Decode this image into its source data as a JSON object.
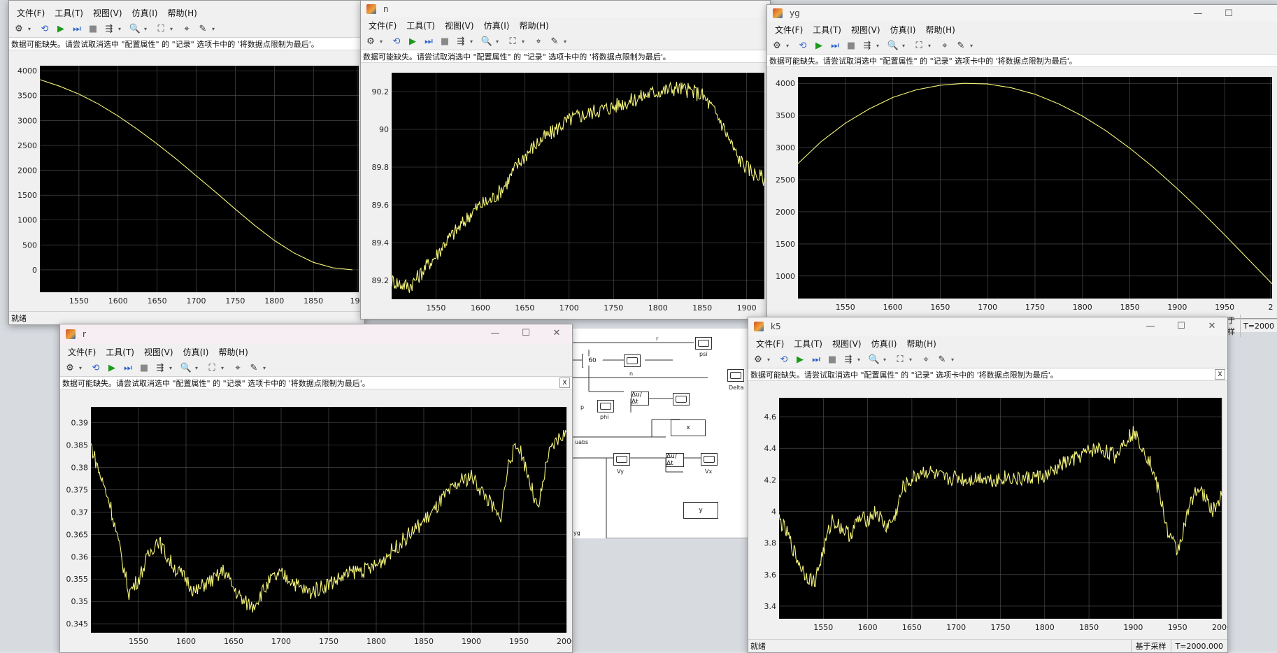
{
  "menus": [
    "文件(F)",
    "工具(T)",
    "视图(V)",
    "仿真(I)",
    "帮助(H)"
  ],
  "warning": "数据可能缺失。请尝试取消选中 \"配置属性\" 的 \"记录\" 选项卡中的 '将数据点限制为最后'。",
  "warning_close": "X",
  "status": {
    "ready": "就绪",
    "sample_based": "基于采样",
    "time_full": "T=2000.000",
    "time_short": "T=2000"
  },
  "window_controls": {
    "minimize": "—",
    "maximize": "☐",
    "close": "✕"
  },
  "toolbar_icons": [
    "gear-icon",
    "restore-icon",
    "play-icon",
    "step-forward-icon",
    "stop-icon",
    "highlight-icon",
    "zoom-icon",
    "fit-icon",
    "cursor-icon",
    "edit-icon"
  ],
  "trace_color": "#f5f57a",
  "windows": {
    "w1": {
      "title": ""
    },
    "n": {
      "title": "n"
    },
    "yg": {
      "title": "yg"
    },
    "r": {
      "title": "r"
    },
    "k5": {
      "title": "k5"
    }
  },
  "diagram": {
    "gain_label": "60",
    "labels": [
      "r",
      "psi",
      "n",
      "Delta",
      "p",
      "phi",
      "uabs",
      "x",
      "Vy",
      "Vx",
      "y",
      "yg"
    ],
    "deriv_label": "Δu/Δt"
  },
  "chart_data": [
    {
      "id": "w1",
      "type": "line",
      "x": [
        1500,
        1525,
        1550,
        1575,
        1600,
        1625,
        1650,
        1675,
        1700,
        1725,
        1750,
        1775,
        1800,
        1825,
        1850,
        1875,
        1900
      ],
      "series": [
        {
          "values": [
            3820,
            3690,
            3530,
            3330,
            3090,
            2820,
            2530,
            2220,
            1890,
            1560,
            1220,
            890,
            590,
            340,
            150,
            40,
            0
          ]
        }
      ],
      "xlim": [
        1500,
        1908
      ],
      "ylim": [
        -450,
        4100
      ],
      "xticks": [
        1550,
        1600,
        1650,
        1700,
        1750,
        1800,
        1850,
        "190"
      ],
      "yticks": [
        0,
        500,
        1000,
        1500,
        2000,
        2500,
        3000,
        3500,
        4000
      ]
    },
    {
      "id": "n",
      "type": "line",
      "x": [
        1500,
        1510,
        1520,
        1530,
        1540,
        1550,
        1560,
        1570,
        1580,
        1590,
        1600,
        1610,
        1620,
        1630,
        1640,
        1650,
        1660,
        1670,
        1680,
        1690,
        1700,
        1710,
        1720,
        1730,
        1740,
        1750,
        1760,
        1770,
        1780,
        1790,
        1800,
        1810,
        1820,
        1830,
        1840,
        1850,
        1860,
        1870,
        1880,
        1890,
        1900,
        1910,
        1920
      ],
      "series": [
        {
          "values": [
            89.2,
            89.18,
            89.17,
            89.22,
            89.28,
            89.33,
            89.4,
            89.45,
            89.5,
            89.56,
            89.6,
            89.62,
            89.66,
            89.72,
            89.8,
            89.86,
            89.91,
            89.95,
            89.98,
            90.02,
            90.05,
            90.07,
            90.08,
            90.1,
            90.11,
            90.12,
            90.14,
            90.15,
            90.17,
            90.19,
            90.2,
            90.21,
            90.22,
            90.21,
            90.2,
            90.18,
            90.12,
            90.05,
            89.95,
            89.85,
            89.8,
            89.76,
            89.74
          ]
        }
      ],
      "xlim": [
        1500,
        1920
      ],
      "ylim": [
        89.1,
        90.3
      ],
      "xticks": [
        1550,
        1600,
        1650,
        1700,
        1750,
        1800,
        1850,
        1900
      ],
      "yticks": [
        89.2,
        89.4,
        89.6,
        89.8,
        90,
        90.2
      ],
      "noisy": true
    },
    {
      "id": "yg",
      "type": "line",
      "x": [
        1500,
        1525,
        1550,
        1575,
        1600,
        1625,
        1650,
        1675,
        1700,
        1725,
        1750,
        1775,
        1800,
        1825,
        1850,
        1875,
        1900,
        1925,
        1950,
        1975,
        2000
      ],
      "series": [
        {
          "values": [
            2750,
            3100,
            3380,
            3600,
            3780,
            3900,
            3970,
            4000,
            3990,
            3930,
            3830,
            3680,
            3490,
            3260,
            2990,
            2690,
            2360,
            2010,
            1640,
            1260,
            880
          ]
        }
      ],
      "xlim": [
        1500,
        2000
      ],
      "ylim": [
        650,
        4100
      ],
      "xticks": [
        1550,
        1600,
        1650,
        1700,
        1750,
        1800,
        1850,
        1900,
        1950,
        "2"
      ],
      "yticks": [
        1000,
        1500,
        2000,
        2500,
        3000,
        3500,
        4000
      ]
    },
    {
      "id": "r",
      "type": "line",
      "x": [
        1500,
        1510,
        1520,
        1530,
        1540,
        1550,
        1560,
        1570,
        1580,
        1590,
        1600,
        1610,
        1620,
        1630,
        1640,
        1650,
        1660,
        1670,
        1680,
        1690,
        1700,
        1710,
        1720,
        1730,
        1740,
        1750,
        1760,
        1770,
        1780,
        1790,
        1800,
        1810,
        1820,
        1830,
        1840,
        1850,
        1860,
        1870,
        1880,
        1890,
        1900,
        1910,
        1920,
        1930,
        1940,
        1950,
        1960,
        1970,
        1980,
        1990,
        2000
      ],
      "series": [
        {
          "values": [
            0.385,
            0.378,
            0.372,
            0.362,
            0.352,
            0.355,
            0.36,
            0.364,
            0.36,
            0.357,
            0.355,
            0.352,
            0.354,
            0.355,
            0.357,
            0.353,
            0.35,
            0.349,
            0.352,
            0.355,
            0.356,
            0.355,
            0.353,
            0.352,
            0.353,
            0.354,
            0.355,
            0.356,
            0.357,
            0.357,
            0.358,
            0.36,
            0.362,
            0.364,
            0.366,
            0.368,
            0.37,
            0.373,
            0.375,
            0.377,
            0.378,
            0.375,
            0.372,
            0.368,
            0.382,
            0.385,
            0.378,
            0.37,
            0.382,
            0.386,
            0.388
          ]
        }
      ],
      "xlim": [
        1500,
        2000
      ],
      "ylim": [
        0.343,
        0.3935
      ],
      "xticks": [
        1550,
        1600,
        1650,
        1700,
        1750,
        1800,
        1850,
        1900,
        1950,
        2000
      ],
      "yticks": [
        0.345,
        0.35,
        0.355,
        0.36,
        0.365,
        0.37,
        0.375,
        0.38,
        0.385,
        0.39
      ],
      "noisy": true
    },
    {
      "id": "k5",
      "type": "line",
      "x": [
        1500,
        1510,
        1520,
        1530,
        1540,
        1550,
        1560,
        1570,
        1580,
        1590,
        1600,
        1610,
        1620,
        1630,
        1640,
        1650,
        1660,
        1670,
        1680,
        1690,
        1700,
        1710,
        1720,
        1730,
        1740,
        1750,
        1760,
        1770,
        1780,
        1790,
        1800,
        1810,
        1820,
        1830,
        1840,
        1850,
        1860,
        1870,
        1880,
        1890,
        1900,
        1910,
        1920,
        1930,
        1940,
        1950,
        1960,
        1970,
        1980,
        1990,
        2000
      ],
      "series": [
        {
          "values": [
            3.95,
            3.85,
            3.7,
            3.6,
            3.55,
            3.75,
            3.95,
            3.9,
            3.85,
            3.95,
            3.95,
            4.0,
            3.9,
            3.95,
            4.15,
            4.2,
            4.25,
            4.25,
            4.22,
            4.2,
            4.22,
            4.2,
            4.21,
            4.22,
            4.2,
            4.21,
            4.22,
            4.2,
            4.21,
            4.22,
            4.22,
            4.25,
            4.3,
            4.32,
            4.35,
            4.38,
            4.4,
            4.38,
            4.35,
            4.45,
            4.5,
            4.42,
            4.3,
            4.1,
            3.85,
            3.75,
            3.95,
            4.15,
            4.1,
            4.0,
            4.1
          ]
        }
      ],
      "xlim": [
        1500,
        2000
      ],
      "ylim": [
        3.32,
        4.72
      ],
      "xticks": [
        1550,
        1600,
        1650,
        1700,
        1750,
        1800,
        1850,
        1900,
        1950,
        2000
      ],
      "yticks": [
        3.4,
        3.6,
        3.8,
        4,
        4.2,
        4.4,
        4.6
      ],
      "noisy": true
    }
  ]
}
